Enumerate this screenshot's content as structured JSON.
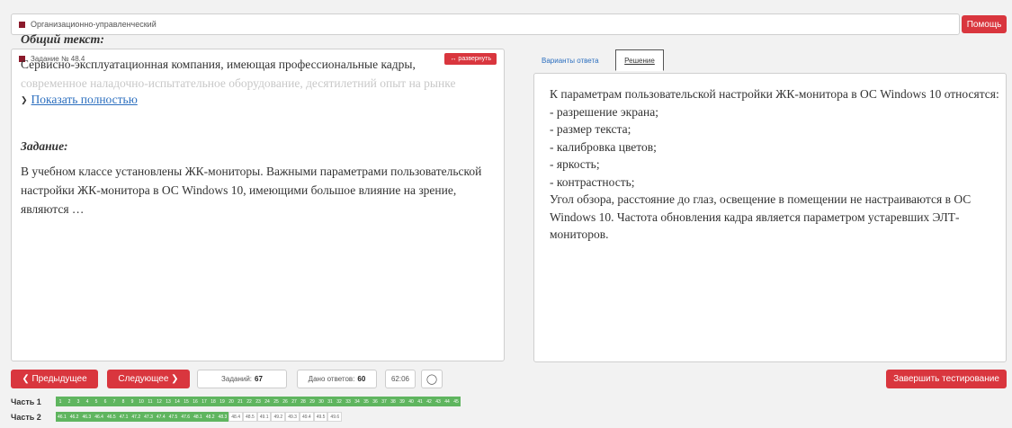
{
  "header": {
    "category": "Организационно-управленческий",
    "help_label": "Помощь"
  },
  "task": {
    "number_label": "Задание № 48.4",
    "expand_label": "↔ развернуть",
    "general_title": "Общий текст:",
    "general_text": "Сервисно-эксплуатационная компания, имеющая профессиональные кадры,",
    "general_text_faded": "современное наладочно-испытательное оборудование, десятилетний опыт на рынке",
    "show_more": "Показать полностью",
    "task_title": "Задание:",
    "task_text": "В учебном классе установлены  ЖК-мониторы. Важными параметрами пользовательской настройки ЖК-монитора в ОС Windows 10, имеющими большое влияние на зрение, являются …"
  },
  "tabs": {
    "variants": "Варианты ответа",
    "solution": "Решение"
  },
  "solution": {
    "lines": [
      "К параметрам пользовательской настройки ЖК-монитора в ОС Windows 10 относятся:",
      "- разрешение экрана;",
      "- размер текста;",
      "- калибровка цветов;",
      "- яркость;",
      "- контрастность;",
      "Угол обзора, расстояние до глаз, освещение в помещении не настраиваются в ОС Windows 10. Частота обновления кадра является параметром устаревших ЭЛТ-мониторов."
    ]
  },
  "controls": {
    "prev_label": "❮ Предыдущее",
    "next_label": "Следующее ❯",
    "tasks_label": "Заданий:",
    "tasks_count": "67",
    "answers_label": "Дано ответов:",
    "answers_count": "60",
    "timer": "62:06",
    "finish_label": "Завершить тестирование"
  },
  "parts": [
    {
      "label": "Часть 1",
      "cells": [
        {
          "t": "1",
          "s": "g"
        },
        {
          "t": "2",
          "s": "g"
        },
        {
          "t": "3",
          "s": "g"
        },
        {
          "t": "4",
          "s": "g"
        },
        {
          "t": "5",
          "s": "g"
        },
        {
          "t": "6",
          "s": "g"
        },
        {
          "t": "7",
          "s": "g"
        },
        {
          "t": "8",
          "s": "g"
        },
        {
          "t": "9",
          "s": "g"
        },
        {
          "t": "10",
          "s": "g"
        },
        {
          "t": "11",
          "s": "g"
        },
        {
          "t": "12",
          "s": "g"
        },
        {
          "t": "13",
          "s": "g"
        },
        {
          "t": "14",
          "s": "g"
        },
        {
          "t": "15",
          "s": "g"
        },
        {
          "t": "16",
          "s": "g"
        },
        {
          "t": "17",
          "s": "g"
        },
        {
          "t": "18",
          "s": "g"
        },
        {
          "t": "19",
          "s": "g"
        },
        {
          "t": "20",
          "s": "g"
        },
        {
          "t": "21",
          "s": "g"
        },
        {
          "t": "22",
          "s": "g"
        },
        {
          "t": "23",
          "s": "g"
        },
        {
          "t": "24",
          "s": "g"
        },
        {
          "t": "25",
          "s": "g"
        },
        {
          "t": "26",
          "s": "g"
        },
        {
          "t": "27",
          "s": "g"
        },
        {
          "t": "28",
          "s": "g"
        },
        {
          "t": "29",
          "s": "g"
        },
        {
          "t": "30",
          "s": "g"
        },
        {
          "t": "31",
          "s": "g"
        },
        {
          "t": "32",
          "s": "g"
        },
        {
          "t": "33",
          "s": "g"
        },
        {
          "t": "34",
          "s": "g"
        },
        {
          "t": "35",
          "s": "g"
        },
        {
          "t": "36",
          "s": "g"
        },
        {
          "t": "37",
          "s": "g"
        },
        {
          "t": "38",
          "s": "g"
        },
        {
          "t": "39",
          "s": "g"
        },
        {
          "t": "40",
          "s": "g"
        },
        {
          "t": "41",
          "s": "g"
        },
        {
          "t": "42",
          "s": "g"
        },
        {
          "t": "43",
          "s": "g"
        },
        {
          "t": "44",
          "s": "g"
        },
        {
          "t": "45",
          "s": "g"
        }
      ]
    },
    {
      "label": "Часть 2",
      "cells": [
        {
          "t": "46.1",
          "s": "g"
        },
        {
          "t": "46.2",
          "s": "g"
        },
        {
          "t": "46.3",
          "s": "g"
        },
        {
          "t": "46.4",
          "s": "g"
        },
        {
          "t": "46.5",
          "s": "g"
        },
        {
          "t": "47.1",
          "s": "g"
        },
        {
          "t": "47.2",
          "s": "g"
        },
        {
          "t": "47.3",
          "s": "g"
        },
        {
          "t": "47.4",
          "s": "g"
        },
        {
          "t": "47.5",
          "s": "g"
        },
        {
          "t": "47.6",
          "s": "g"
        },
        {
          "t": "48.1",
          "s": "g"
        },
        {
          "t": "48.2",
          "s": "g"
        },
        {
          "t": "48.3",
          "s": "g"
        },
        {
          "t": "48.4",
          "s": "w"
        },
        {
          "t": "48.5",
          "s": "w"
        },
        {
          "t": "49.1",
          "s": "w"
        },
        {
          "t": "49.2",
          "s": "w"
        },
        {
          "t": "49.3",
          "s": "w"
        },
        {
          "t": "49.4",
          "s": "w"
        },
        {
          "t": "49.5",
          "s": "w"
        },
        {
          "t": "49.6",
          "s": "w"
        }
      ]
    }
  ]
}
